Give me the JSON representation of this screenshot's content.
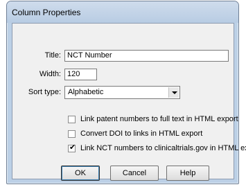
{
  "dialog": {
    "title": "Column Properties"
  },
  "fields": {
    "title_label": "Title:",
    "title_value": "NCT Number",
    "width_label": "Width:",
    "width_value": "120",
    "sort_label": "Sort type:",
    "sort_value": "Alphabetic"
  },
  "options": [
    {
      "label": "Link patent numbers to full text in HTML export",
      "checked": false
    },
    {
      "label": "Convert DOI to links in HTML export",
      "checked": false
    },
    {
      "label": "Link NCT numbers to clinicaltrials.gov in HTML exp",
      "checked": true
    }
  ],
  "buttons": {
    "ok": "OK",
    "cancel": "Cancel",
    "help": "Help"
  },
  "icons": {
    "checkmark": "check-icon",
    "dropdown": "chevron-down-icon"
  }
}
